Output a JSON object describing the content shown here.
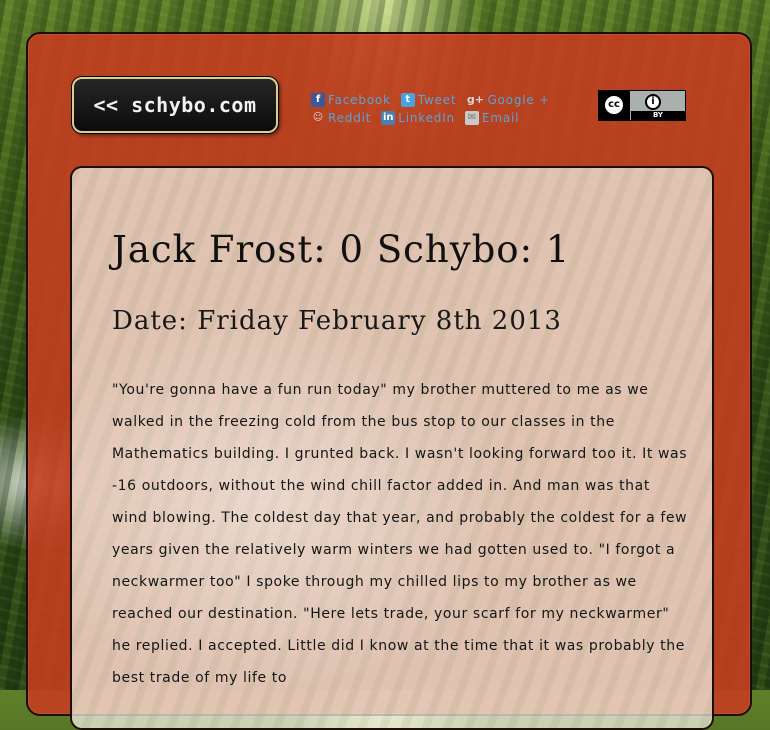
{
  "header": {
    "logo_text": "<< schybo.com"
  },
  "share": {
    "facebook": "Facebook",
    "tweet": "Tweet",
    "google": "Google +",
    "reddit": "Reddit",
    "linkedin": "LinkedIn",
    "email": "Email"
  },
  "license": {
    "cc_text": "cc",
    "by_text": "BY"
  },
  "article": {
    "title": "Jack Frost: 0 Schybo: 1",
    "date": "Date: Friday February 8th 2013",
    "body": "\"You're gonna have a fun run today\" my brother muttered to me as we walked in the freezing cold from the bus stop to our classes in the Mathematics building. I grunted back. I wasn't looking forward too it. It was -16 outdoors, without the wind chill factor added in. And man was that wind blowing. The coldest day that year, and probably the coldest for a few years given the relatively warm winters we had gotten used to. \"I forgot a neckwarmer too\" I spoke through my chilled lips to my brother as we reached our destination. \"Here lets trade, your scarf for my neckwarmer\" he replied. I accepted. Little did I know at the time that it was probably the best trade of my life to"
  },
  "colors": {
    "panel": "#c43e20",
    "content_bg": "#eeece1",
    "logo_border": "#d9cf96",
    "share_link": "#5aa3d6"
  }
}
